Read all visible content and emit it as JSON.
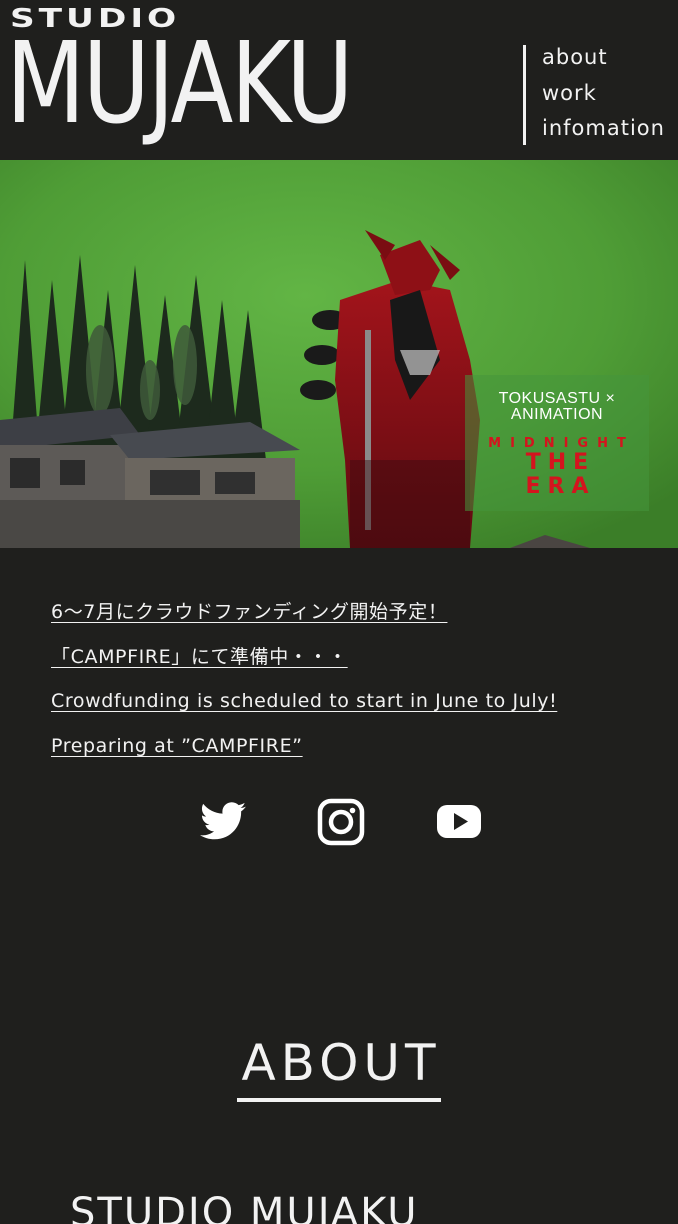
{
  "header": {
    "logo_top": "STUDIO",
    "logo_main": "MUJAKU",
    "nav": [
      {
        "label": "about"
      },
      {
        "label": "work"
      },
      {
        "label": "infomation"
      }
    ]
  },
  "hero": {
    "badge_line1": "TOKUSASTU ×",
    "badge_line2": "ANIMATION",
    "badge_sub": "MIDNIGHT",
    "badge_title_1": "THE",
    "badge_title_2": "ERA"
  },
  "announcement": {
    "lines": [
      "6〜7月にクラウドファンディング開始予定！",
      "「CAMPFIRE」にて準備中・・・",
      "Crowdfunding is scheduled to start in June to July!",
      "Preparing at ”CAMPFIRE”"
    ]
  },
  "social": {
    "icons": [
      "twitter-icon",
      "instagram-icon",
      "youtube-icon"
    ]
  },
  "about": {
    "heading": "ABOUT",
    "subheading": "STUDIO MUJAKU"
  },
  "colors": {
    "background": "#1f1f1d",
    "text": "#f2f2f2",
    "green_screen": "#55a83a",
    "accent_red": "#d4141e"
  }
}
